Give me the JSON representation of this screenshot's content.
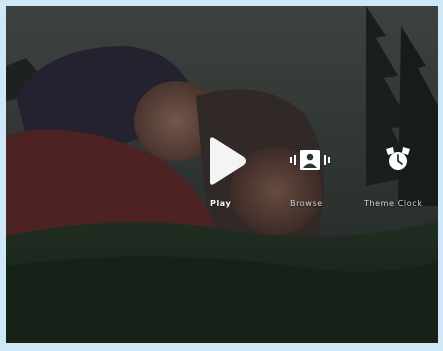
{
  "menu": {
    "items": [
      {
        "label": "Play",
        "icon": "play-icon",
        "selected": true
      },
      {
        "label": "Browse",
        "icon": "browse-icon",
        "selected": false
      },
      {
        "label": "Theme Clock",
        "icon": "theme-clock-icon",
        "selected": false
      }
    ]
  },
  "colors": {
    "frame_border": "#cfe8f7",
    "icon_white": "#ffffff",
    "label_selected": "#ffffff",
    "label_normal": "#d7d7d7"
  }
}
